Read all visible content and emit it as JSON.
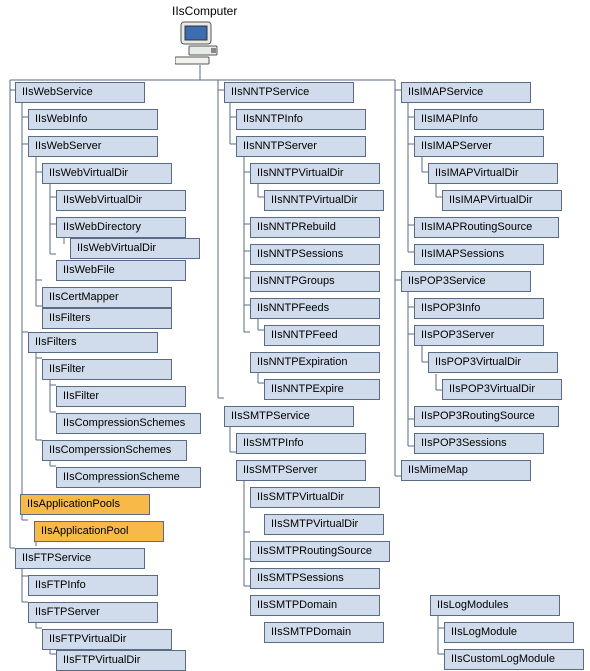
{
  "title": "IIsComputer",
  "tree": {
    "IIsWebService": {
      "children": {
        "IIsWebInfo": {},
        "IIsWebServer": {
          "children": {
            "IIsWebVirtualDir": {
              "children": {
                "IIsWebVirtualDir_2": {
                  "label": "IIsWebVirtualDir"
                },
                "IIsWebDirectory": {
                  "children": {
                    "IIsWebVirtualDir_3": {
                      "label": "IIsWebVirtualDir"
                    }
                  }
                },
                "IIsWebFile": {}
              }
            },
            "IIsCertMapper": {},
            "IIsFilters_srv": {
              "label": "IIsFilters"
            }
          }
        },
        "IIsFilters": {
          "children": {
            "IIsFilter": {
              "children": {
                "IIsFilter_2": {
                  "label": "IIsFilter"
                },
                "IIsCompressionSchemes": {}
              }
            },
            "IIsComperssionSchemes": {
              "children": {
                "IIsCompressionScheme": {}
              }
            }
          }
        },
        "IIsApplicationPools": {
          "highlight": true,
          "children": {
            "IIsApplicationPool": {
              "highlight": true
            }
          }
        }
      }
    },
    "IIsFTPService": {
      "children": {
        "IIsFTPInfo": {},
        "IIsFTPServer": {
          "children": {
            "IIsFTPVirtualDir": {
              "children": {
                "IIsFTPVirtualDir_2": {
                  "label": "IIsFTPVirtualDir"
                }
              }
            }
          }
        }
      }
    },
    "IIsNNTPService": {
      "children": {
        "IIsNNTPInfo": {},
        "IIsNNTPServer": {
          "children": {
            "IIsNNTPVirtualDir": {
              "children": {
                "IIsNNTPVirtualDir_2": {
                  "label": "IIsNNTPVirtualDir"
                }
              }
            },
            "IIsNNTPRebuild": {},
            "IIsNNTPSessions": {},
            "IIsNNTPGroups": {},
            "IIsNNTPFeeds": {
              "children": {
                "IIsNNTPFeed": {}
              }
            },
            "IIsNNTPExpiration": {
              "children": {
                "IIsNNTPExpire": {}
              }
            }
          }
        }
      }
    },
    "IIsSMTPService": {
      "children": {
        "IIsSMTPInfo": {},
        "IIsSMTPServer": {
          "children": {
            "IIsSMTPVirtualDir": {
              "children": {
                "IIsSMTPVirtualDir_2": {
                  "label": "IIsSMTPVirtualDir"
                }
              }
            },
            "IIsSMTPRoutingSource": {},
            "IIsSMTPSessions": {},
            "IIsSMTPDomain": {
              "children": {
                "IIsSMTPDomain_2": {
                  "label": "IIsSMTPDomain"
                }
              }
            }
          }
        }
      }
    },
    "IIsIMAPService": {
      "children": {
        "IIsIMAPInfo": {},
        "IIsIMAPServer": {
          "children": {
            "IIsIMAPVirtualDir": {
              "children": {
                "IIsIMAPVirtualDir_2": {
                  "label": "IIsIMAPVirtualDir"
                }
              }
            }
          }
        },
        "IIsIMAPRoutingSource": {},
        "IIsIMAPSessions": {}
      }
    },
    "IIsPOP3Service": {
      "children": {
        "IIsPOP3Info": {},
        "IIsPOP3Server": {
          "children": {
            "IIsPOP3VirtualDir": {
              "children": {
                "IIsPOP3VirtualDir_2": {
                  "label": "IIsPOP3VirtualDir"
                }
              }
            }
          }
        },
        "IIsPOP3RoutingSource": {},
        "IIsPOP3Sessions": {}
      }
    },
    "IIsMimeMap": {},
    "IIsLogModules": {
      "children": {
        "IIsLogModule": {},
        "IIsCustomLogModule": {}
      }
    }
  }
}
